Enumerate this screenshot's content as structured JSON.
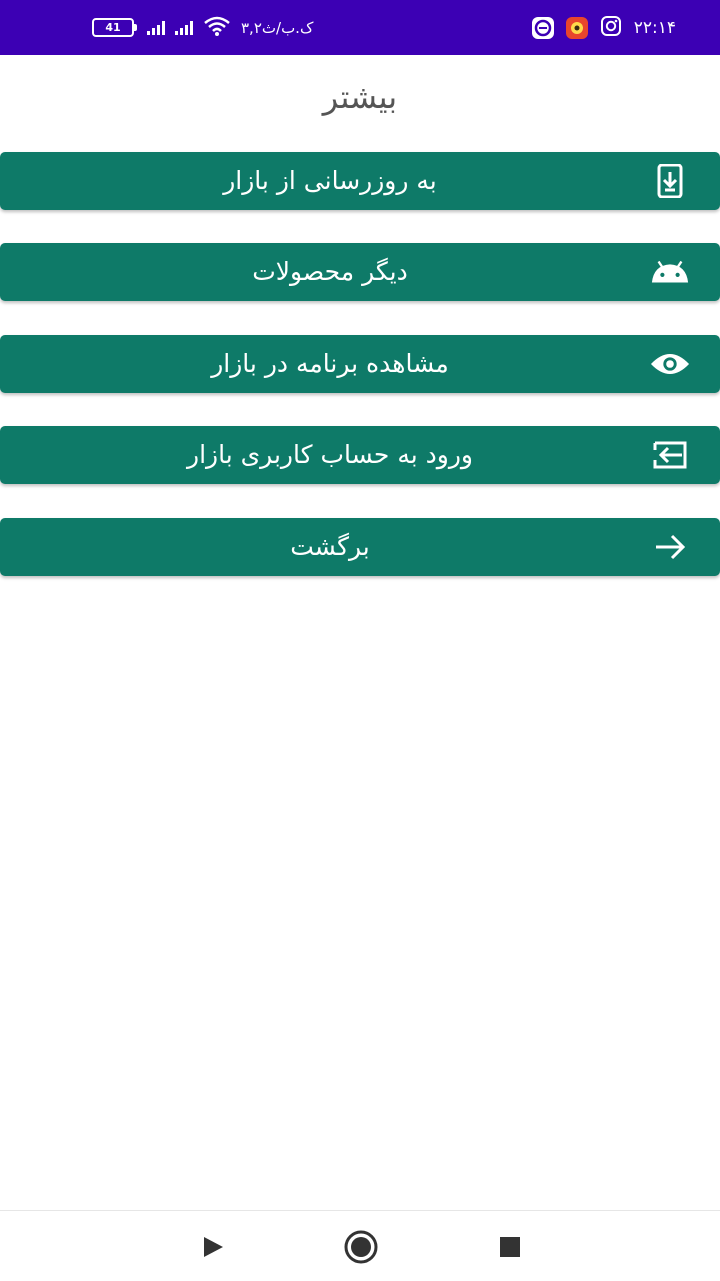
{
  "status_bar": {
    "time": "۲۲:۱۴",
    "speed": "۳,۲ک.ب/ث",
    "battery": "41",
    "background_color": "#3c00b4",
    "right_icons": [
      "instagram-icon",
      "notification-app-icon",
      "browser-app-icon"
    ]
  },
  "page": {
    "title": "بیشتر"
  },
  "menu": {
    "color": "#0e7a68",
    "items": [
      {
        "label": "به روزرسانی از بازار",
        "icon": "download-phone-icon"
      },
      {
        "label": "دیگر محصولات",
        "icon": "android-icon"
      },
      {
        "label": "مشاهده برنامه در بازار",
        "icon": "eye-icon"
      },
      {
        "label": "ورود به حساب کاربری بازار",
        "icon": "login-icon"
      },
      {
        "label": "برگشت",
        "icon": "arrow-right-icon"
      }
    ]
  },
  "nav_bar": {
    "buttons": [
      "back-icon",
      "home-icon",
      "recents-icon"
    ]
  }
}
